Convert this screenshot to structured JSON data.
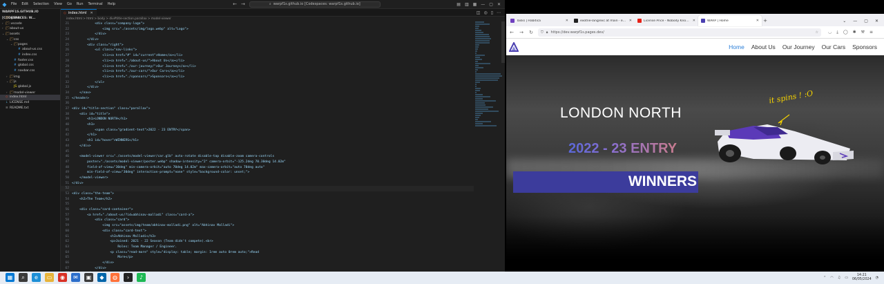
{
  "vscode": {
    "menu": [
      "File",
      "Edit",
      "Selection",
      "View",
      "Go",
      "Run",
      "Terminal",
      "Help"
    ],
    "search": "warpf1s.github.io [Codespaces: warpf1s.github.io]",
    "explorer_header": "WARPF1S.GITHUB.IO [CODESPACES: W...",
    "tree": [
      {
        "label": ".github",
        "depth": 0,
        "kind": "folder",
        "open": false
      },
      {
        "label": ".vscode",
        "depth": 0,
        "kind": "folder",
        "open": false
      },
      {
        "label": "about-us",
        "depth": 0,
        "kind": "folder",
        "open": false
      },
      {
        "label": "assets",
        "depth": 0,
        "kind": "folder",
        "open": true
      },
      {
        "label": "css",
        "depth": 1,
        "kind": "folder",
        "open": true
      },
      {
        "label": "pages",
        "depth": 2,
        "kind": "folder",
        "open": true
      },
      {
        "label": "about-us.css",
        "depth": 3,
        "kind": "css"
      },
      {
        "label": "index.css",
        "depth": 3,
        "kind": "css"
      },
      {
        "label": "footer.css",
        "depth": 2,
        "kind": "css"
      },
      {
        "label": "global.css",
        "depth": 2,
        "kind": "css"
      },
      {
        "label": "navbar.css",
        "depth": 2,
        "kind": "css"
      },
      {
        "label": "img",
        "depth": 1,
        "kind": "folder",
        "open": false
      },
      {
        "label": "js",
        "depth": 1,
        "kind": "folder",
        "open": true
      },
      {
        "label": "global.js",
        "depth": 2,
        "kind": "js"
      },
      {
        "label": "model-viewer",
        "depth": 1,
        "kind": "folder",
        "open": false
      },
      {
        "label": "index.html",
        "depth": 0,
        "kind": "html",
        "active": true
      },
      {
        "label": "LICENSE.md",
        "depth": 0,
        "kind": "md"
      },
      {
        "label": "README.txt",
        "depth": 0,
        "kind": "txt"
      }
    ],
    "tab_label": "index.html",
    "breadcrumb": "index.html > html > body > div#title-section.parallax > model-viewer",
    "current_line": 52,
    "code": [
      {
        "n": "21",
        "t": "            <div class=\"company-logo\">"
      },
      {
        "n": "22",
        "t": "                <img src=\"./assets/img/logo.webp\" alt=\"Logo\">"
      },
      {
        "n": "23",
        "t": "            </div>"
      },
      {
        "n": "24",
        "t": "        </div>"
      },
      {
        "n": "25",
        "t": "        <div class=\"right\">"
      },
      {
        "n": "26",
        "t": "            <ul class=\"nav-links\">"
      },
      {
        "n": "27",
        "t": "                <li><a href=\"#\" id=\"current\">Home</a></li>"
      },
      {
        "n": "28",
        "t": "                <li><a href=\"./about-us/\">About Us</a></li>"
      },
      {
        "n": "29",
        "t": "                <li><a href=\"./our-journey/\">Our Journey</a></li>"
      },
      {
        "n": "30",
        "t": "                <li><a href=\"./our-cars/\">Our Cars</a></li>"
      },
      {
        "n": "31",
        "t": "                <li><a href=\"./sponsors/\">Sponsors</a></li>"
      },
      {
        "n": "32",
        "t": "            </ul>"
      },
      {
        "n": "33",
        "t": "        </div>"
      },
      {
        "n": "34",
        "t": "    </nav>"
      },
      {
        "n": "35",
        "t": "</header>"
      },
      {
        "n": "36",
        "t": ""
      },
      {
        "n": "37",
        "t": "<div id=\"title-section\" class=\"parallax\">"
      },
      {
        "n": "38",
        "t": "    <div id=\"title\">"
      },
      {
        "n": "39",
        "t": "        <h1>LONDON NORTH</h1>"
      },
      {
        "n": "40",
        "t": "        <h1>"
      },
      {
        "n": "41",
        "t": "            <span class=\"gradient-text\">2022 - 23 ENTRY</span>"
      },
      {
        "n": "42",
        "t": "        </h1>"
      },
      {
        "n": "43",
        "t": "        <h1 id=\"hover\">WINNERS</h1>"
      },
      {
        "n": "44",
        "t": "    </div>"
      },
      {
        "n": "45",
        "t": ""
      },
      {
        "n": "46",
        "t": "    <model-viewer src=\"./assets/model-viewer/car.glb\" auto-rotate disable-tap disable-zoom camera-controls"
      },
      {
        "n": "47",
        "t": "        poster=\"./assets/model-viewer/poster.webp\" shadow-intensity=\"2\" camera-orbit=\"-125.2deg 70.30deg 14.02m\""
      },
      {
        "n": "48",
        "t": "        field-of-view=\"30deg\" min-camera-orbit=\"auto 70deg 14.02m\" max-camera-orbit=\"auto 70deg auto\""
      },
      {
        "n": "49",
        "t": "        min-field-of-view=\"30deg\" interaction-prompt=\"none\" style=\"background-color: unset;\">"
      },
      {
        "n": "50",
        "t": "    </model-viewer>"
      },
      {
        "n": "51",
        "t": "</div>"
      },
      {
        "n": "52",
        "t": ""
      },
      {
        "n": "53",
        "t": "<div class=\"the-team\">"
      },
      {
        "n": "54",
        "t": "    <h2>The Team</h2>"
      },
      {
        "n": "55",
        "t": ""
      },
      {
        "n": "56",
        "t": "    <div class=\"card-container\">"
      },
      {
        "n": "57",
        "t": "        <a href=\"./about-us/?id=abhinav-malladi\" class=\"card-a\">"
      },
      {
        "n": "58",
        "t": "            <div class=\"card\">"
      },
      {
        "n": "59",
        "t": "                <img src=\"assets/img/team/abhinav-malladi.png\" alt=\"Abhinav Malladi\">"
      },
      {
        "n": "60",
        "t": "                <div class=\"card-text\">"
      },
      {
        "n": "61",
        "t": "                    <h3>Abhinav Malladi</h3>"
      },
      {
        "n": "62",
        "t": "                    <p>Joined: 2021 - 22 Season (Team didn't compete).<br>"
      },
      {
        "n": "63",
        "t": "                        Roles: Team Manager / Engineer."
      },
      {
        "n": "64",
        "t": "                    <p class=\"read-more\" style=\"display: table; margin: 1rem auto 0rem auto;\">Read"
      },
      {
        "n": "65",
        "t": "                        More</p>"
      },
      {
        "n": "66",
        "t": "                </div>"
      },
      {
        "n": "67",
        "t": "            </div>"
      },
      {
        "n": "68",
        "t": "        </a>"
      },
      {
        "n": "69",
        "t": "        <a href=\"./about-us/?id=aneeq-weerasinghe\" class=\"card-a\">"
      },
      {
        "n": "70",
        "t": "            <div class=\"card\">"
      },
      {
        "n": "71",
        "t": "                <img src=\"assets/img/team/aneeq-weerasinghe.png\" alt=\"Aneeq Weerasinghe\">"
      }
    ]
  },
  "browser": {
    "tabs": [
      {
        "title": "Tasks | Habitica",
        "fav_color": "#6f3fbf",
        "active": false
      },
      {
        "title": "exotne-lang/exc at main · exotne",
        "fav_color": "#222222",
        "active": false
      },
      {
        "title": "License Price - Nobody Knows · YouTube",
        "fav_color": "#e62117",
        "active": false
      },
      {
        "title": "WARP | Home",
        "fav_color": "#4a3fb0",
        "active": true
      }
    ],
    "url": "https://dev.warpf1s.pages.dev/",
    "site": {
      "nav_links": [
        "Home",
        "About Us",
        "Our Journey",
        "Our Cars",
        "Sponsors"
      ],
      "current_link": "Home",
      "title": "LONDON NORTH",
      "subtitle": "2022 - 23 ENTRY",
      "winners": "WINNERS",
      "annotation": "it spins ! :O"
    }
  },
  "taskbar": {
    "time": "14:21",
    "date": "06/05/2024",
    "apps": [
      {
        "name": "windows-start-icon",
        "color": "#0078d4",
        "glyph": "▦"
      },
      {
        "name": "search-icon",
        "color": "#3a3a3a",
        "glyph": "⌕"
      },
      {
        "name": "edge-icon",
        "color": "#1d8fd6",
        "glyph": "e"
      },
      {
        "name": "file-explorer-icon",
        "color": "#e8b43a",
        "glyph": "▭"
      },
      {
        "name": "chrome-icon",
        "color": "#d93025",
        "glyph": "◉"
      },
      {
        "name": "mail-icon",
        "color": "#2c6ecb",
        "glyph": "✉"
      },
      {
        "name": "store-icon",
        "color": "#3b3b3b",
        "glyph": "▣"
      },
      {
        "name": "vscode-icon",
        "color": "#0065a9",
        "glyph": "◆"
      },
      {
        "name": "firefox-icon",
        "color": "#ff7139",
        "glyph": "◍"
      },
      {
        "name": "terminal-icon",
        "color": "#222222",
        "glyph": "›"
      },
      {
        "name": "spotify-icon",
        "color": "#1db954",
        "glyph": "♪"
      }
    ]
  }
}
